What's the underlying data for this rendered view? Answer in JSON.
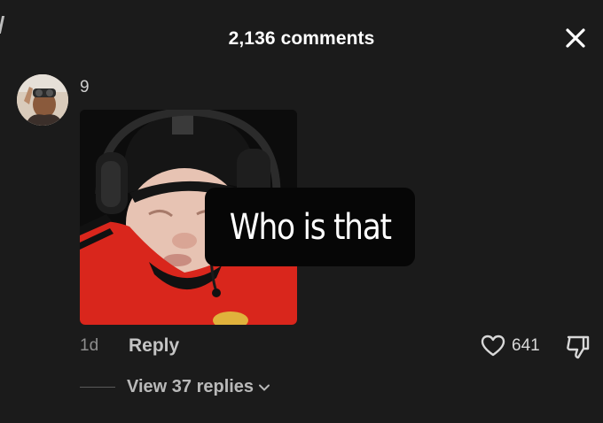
{
  "header": {
    "title": "2,136 comments"
  },
  "comment": {
    "username": "9",
    "sticker_text": "Who is that",
    "time": "1d",
    "reply_label": "Reply",
    "likes": "641"
  },
  "replies": {
    "label": "View 37 replies"
  },
  "icons": {
    "close": "close-icon",
    "like": "heart-outline-icon",
    "dislike": "thumbs-down-icon",
    "chevron": "chevron-down-icon"
  },
  "colors": {
    "background": "#1b1b1b",
    "text_primary": "#ffffff",
    "text_muted": "#8e8e8e",
    "sticker_bg": "#060606",
    "jersey_red": "#d9261c"
  }
}
